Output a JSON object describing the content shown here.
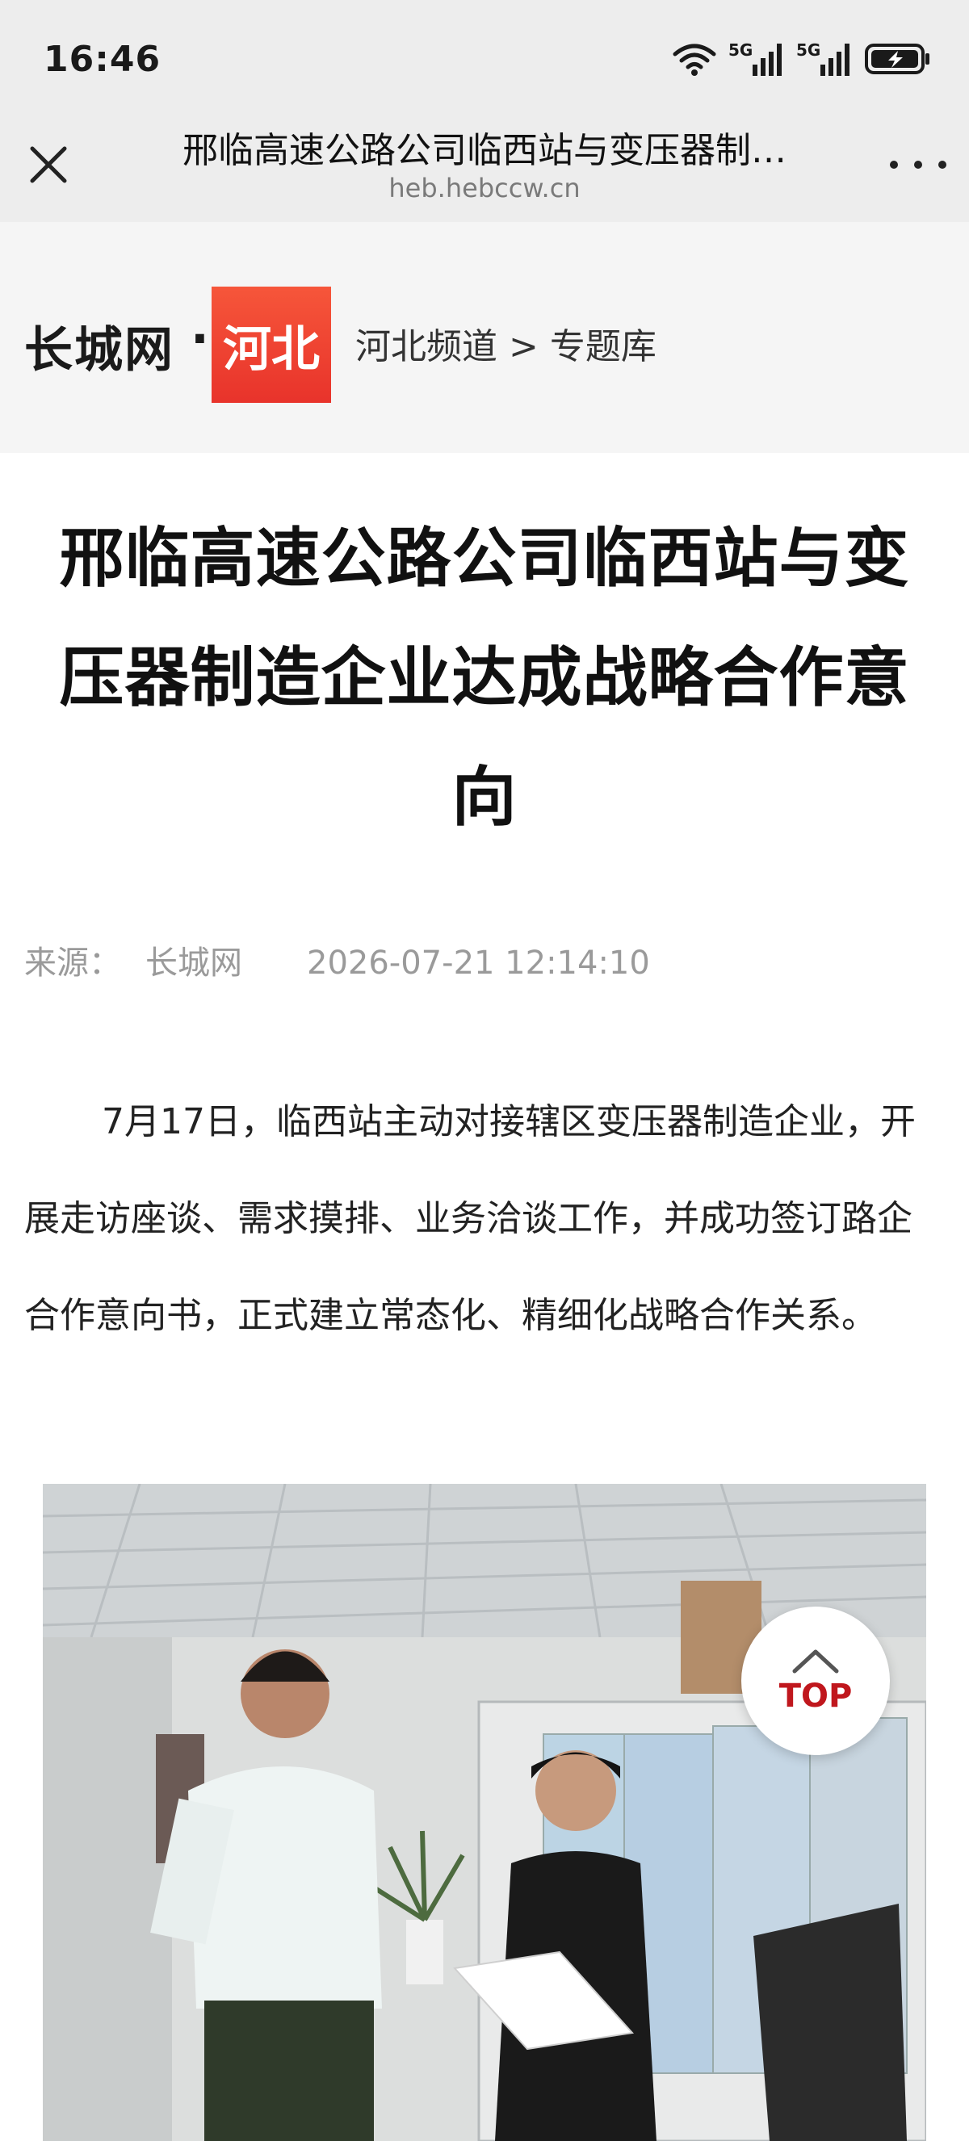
{
  "status_bar": {
    "time": "16:46",
    "signal1_label": "5G",
    "signal2_label": "5G",
    "icons": [
      "wifi-icon",
      "signal-5g-icon",
      "signal-5g-icon",
      "battery-charging-icon"
    ]
  },
  "nav": {
    "title": "邢临高速公路公司临西站与变压器制…",
    "url": "heb.hebccw.cn",
    "close_icon": "close-icon",
    "more_icon": "more-icon"
  },
  "site_header": {
    "brand": "长城网",
    "dot": "·",
    "logo_text": "河北",
    "breadcrumb": "河北频道 > 专题库"
  },
  "article": {
    "title": "邢临高速公路公司临西站与变压器制造企业达成战略合作意向",
    "source_label": "来源：",
    "source": "长城网",
    "date": "2026-07-21 12:14:10",
    "paragraph": "7月17日，临西站主动对接辖区变压器制造企业，开展走访座谈、需求摸排、业务洽谈工作，并成功签订路企合作意向书，正式建立常态化、精细化战略合作关系。"
  },
  "top_button": {
    "label": "TOP",
    "icon": "chevron-up-icon"
  },
  "colors": {
    "logo_red": "#e8332b",
    "top_red": "#c0171d",
    "bar_gray": "#ededed"
  }
}
